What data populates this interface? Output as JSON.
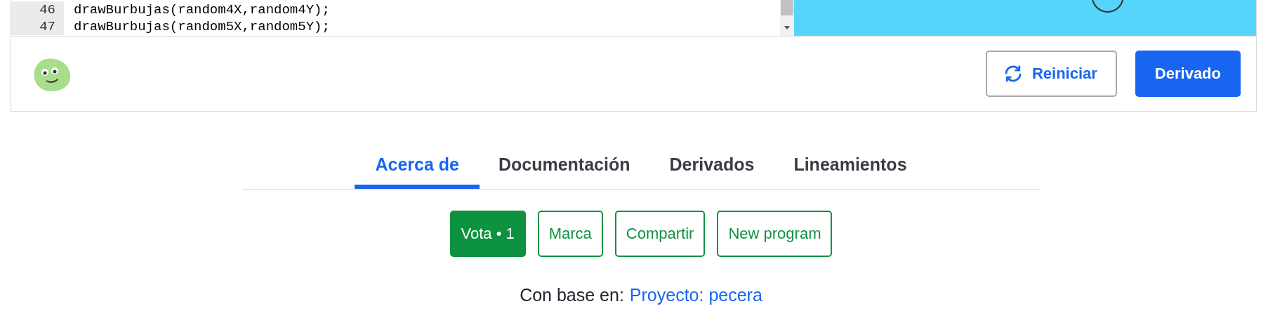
{
  "editor": {
    "lines": [
      {
        "number": "46",
        "code": "drawBurbujas(random4X,random4Y);"
      },
      {
        "number": "47",
        "code": "drawBurbujas(random5X,random5Y);"
      }
    ]
  },
  "toolbar": {
    "buttons": [
      {
        "label": "Reiniciar",
        "kind": "restart"
      },
      {
        "label": "Derivado",
        "kind": "primary"
      }
    ]
  },
  "tabs": [
    {
      "label": "Acerca de",
      "selected": true
    },
    {
      "label": "Documentación",
      "selected": false
    },
    {
      "label": "Derivados",
      "selected": false
    },
    {
      "label": "Lineamientos",
      "selected": false
    }
  ],
  "actions": [
    {
      "label": "Vota • 1",
      "kind": "filled"
    },
    {
      "label": "Marca",
      "kind": "outline"
    },
    {
      "label": "Compartir",
      "kind": "outline"
    },
    {
      "label": "New program",
      "kind": "outline"
    }
  ],
  "based_on": {
    "text": "Con base en:",
    "link": "Proyecto: pecera"
  }
}
